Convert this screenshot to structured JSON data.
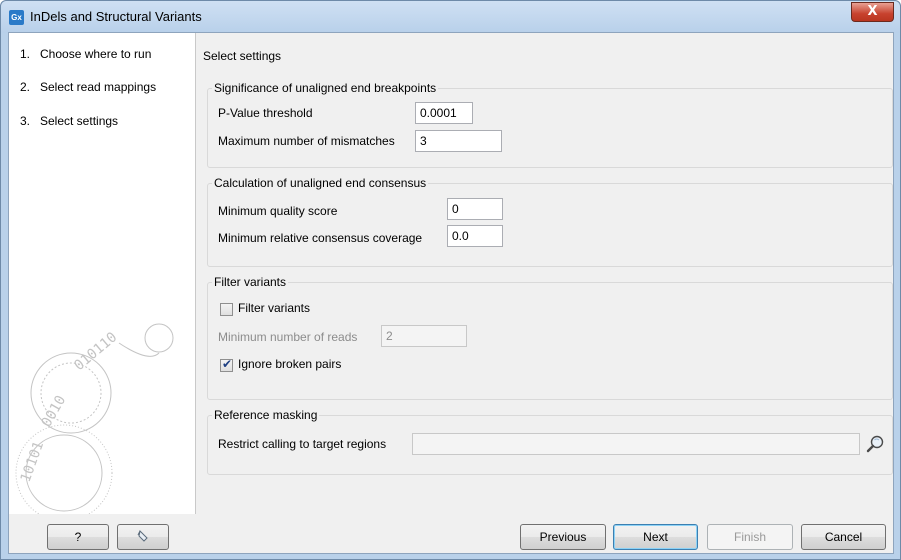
{
  "window": {
    "title": "InDels and Structural Variants",
    "icon_label": "Gx",
    "close_glyph": "X"
  },
  "steps": [
    {
      "number": "1.",
      "label": "Choose where to run"
    },
    {
      "number": "2.",
      "label": "Select read mappings"
    },
    {
      "number": "3.",
      "label": "Select settings"
    }
  ],
  "content": {
    "title": "Select settings",
    "significance": {
      "title": "Significance of unaligned end breakpoints",
      "pvalue_label": "P-Value threshold",
      "pvalue_value": "0.0001",
      "mismatch_label": "Maximum number of mismatches",
      "mismatch_value": "3"
    },
    "consensus": {
      "title": "Calculation of unaligned end consensus",
      "quality_label": "Minimum quality score",
      "quality_value": "0",
      "coverage_label": "Minimum relative consensus coverage",
      "coverage_value": "0.0"
    },
    "filter": {
      "title": "Filter variants",
      "filter_checkbox_label": "Filter variants",
      "filter_checked": false,
      "min_reads_label": "Minimum number of reads",
      "min_reads_value": "2",
      "broken_pairs_label": "Ignore broken pairs",
      "broken_pairs_checked": true
    },
    "masking": {
      "title": "Reference masking",
      "restrict_label": "Restrict calling to target regions",
      "restrict_value": ""
    }
  },
  "buttons": {
    "help": "?",
    "reset_icon": "reset-icon",
    "previous": "Previous",
    "next": "Next",
    "finish": "Finish",
    "cancel": "Cancel"
  }
}
